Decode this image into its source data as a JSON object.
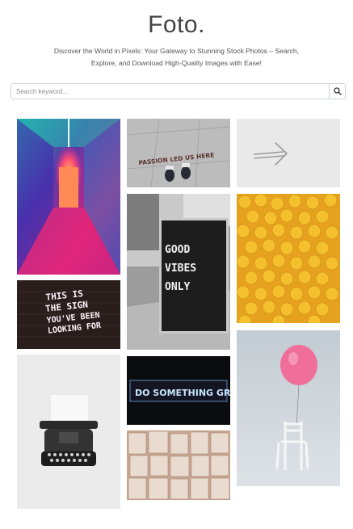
{
  "header": {
    "title": "Foto.",
    "tagline_line1": "Discover the World in Pixels: Your Gateway to Stunning Stock Photos – Search,",
    "tagline_line2": "Explore, and Download High-Quality Images with Ease!"
  },
  "search": {
    "placeholder": "Search keyword...",
    "value": "",
    "button_icon": "search-icon"
  },
  "gallery": {
    "photos": [
      {
        "subject": "neon corridor"
      },
      {
        "subject": "this is the sign neon",
        "text": [
          "THIS IS",
          "THE SIGN",
          "YOU'VE BEEN",
          "LOOKING FOR"
        ]
      },
      {
        "subject": "typewriter"
      },
      {
        "subject": "passion led us here",
        "text": "PASSION LED US HERE"
      },
      {
        "subject": "good vibes only",
        "text": [
          "GOOD",
          "VIBES",
          "ONLY"
        ]
      },
      {
        "subject": "do something great",
        "text": "DO SOMETHING GREAT"
      },
      {
        "subject": "book pages"
      },
      {
        "subject": "arrow on wall"
      },
      {
        "subject": "yellow figurines"
      },
      {
        "subject": "pink balloon chair"
      }
    ]
  }
}
